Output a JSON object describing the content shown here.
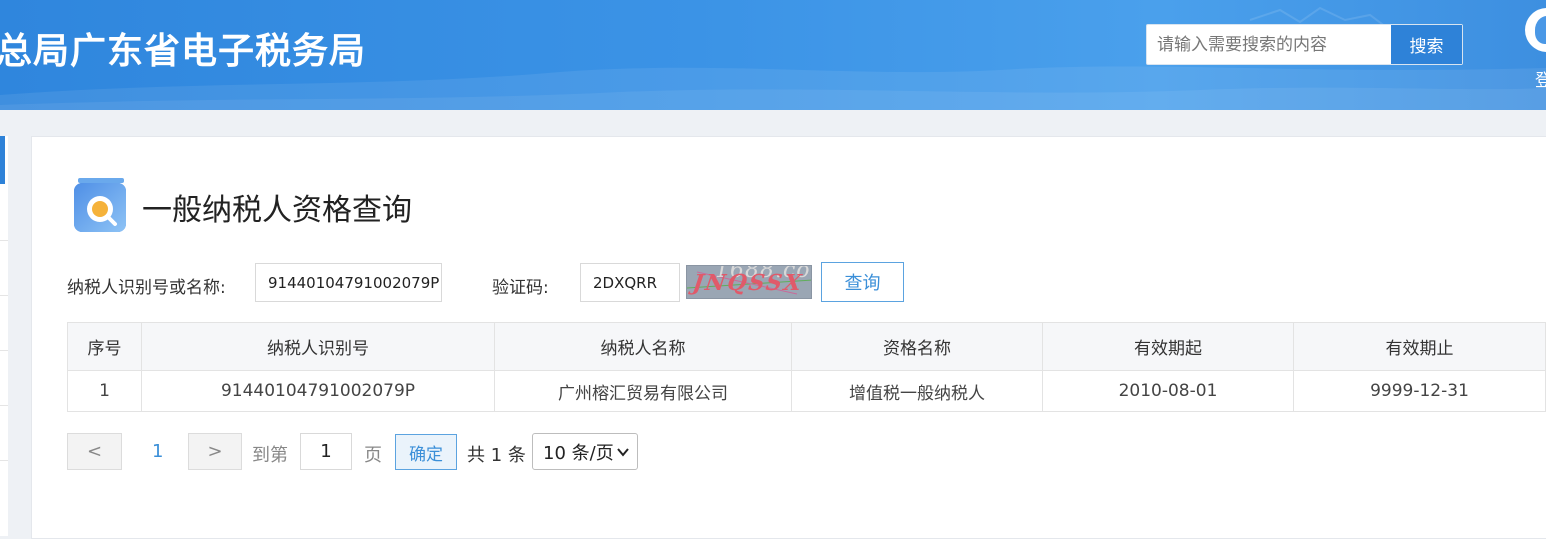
{
  "header": {
    "site_title": "总局广东省电子税务局",
    "search_placeholder": "请输入需要搜索的内容",
    "search_button": "搜索",
    "login_label": "登"
  },
  "page": {
    "title": "一般纳税人资格查询"
  },
  "form": {
    "taxpayer_label": "纳税人识别号或名称:",
    "taxpayer_value": "91440104791002079P",
    "captcha_label": "验证码:",
    "captcha_value": "2DXQRR",
    "captcha_image_text": "JNQSSX",
    "captcha_watermark": "1688.com",
    "query_button": "查询"
  },
  "table": {
    "headers": [
      "序号",
      "纳税人识别号",
      "纳税人名称",
      "资格名称",
      "有效期起",
      "有效期止"
    ],
    "rows": [
      [
        "1",
        "91440104791002079P",
        "广州榕汇贸易有限公司",
        "增值税一般纳税人",
        "2010-08-01",
        "9999-12-31"
      ]
    ]
  },
  "pagination": {
    "prev": "<",
    "next": ">",
    "current_page": "1",
    "goto_label": "到第",
    "goto_value": "1",
    "page_unit": "页",
    "confirm": "确定",
    "total": "共 1 条",
    "page_size": "10 条/页"
  },
  "colors": {
    "header_blue": "#3b93e6",
    "accent_blue": "#2e82d8",
    "link_blue": "#3b8fd8"
  }
}
